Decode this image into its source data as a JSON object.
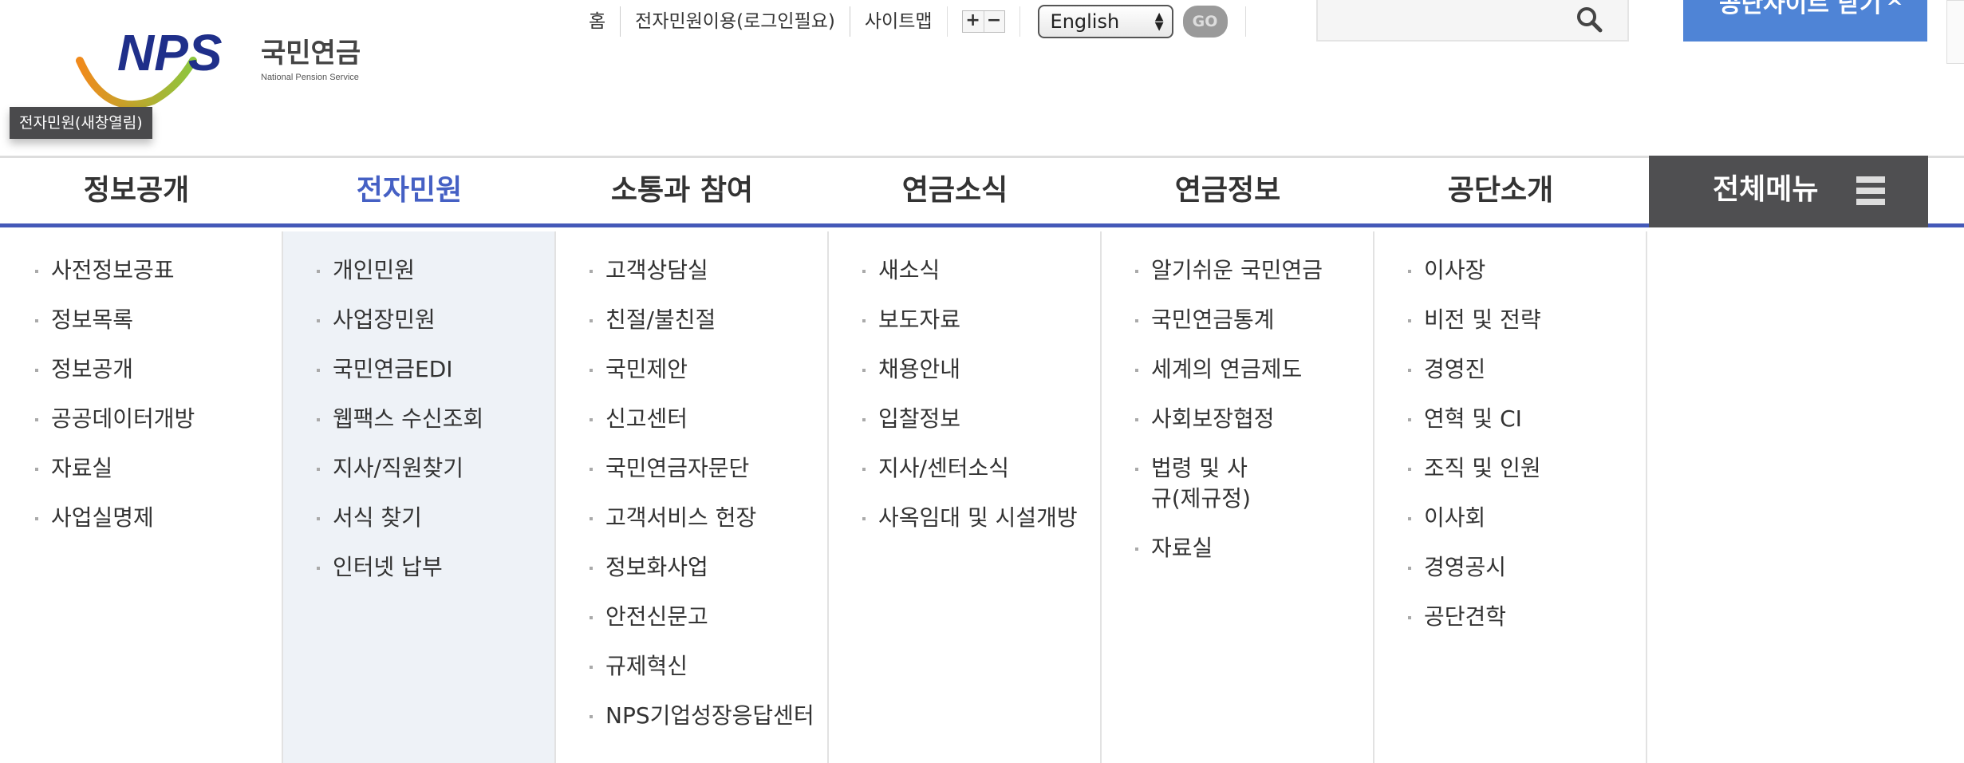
{
  "logo": {
    "text": "NPS",
    "korean": "국민연금",
    "english": "National Pension Service"
  },
  "tooltip": "전자민원(새창열림)",
  "top_links": [
    "홈",
    "전자민원이용(로그인필요)",
    "사이트맵"
  ],
  "zoom": {
    "plus": "+",
    "minus": "−"
  },
  "language": {
    "selected": "English",
    "go": "GO"
  },
  "search": {
    "placeholder": ""
  },
  "close_button": {
    "label": "공단사이트 닫기",
    "icon": "caret-up"
  },
  "nav": {
    "items": [
      "정보공개",
      "전자민원",
      "소통과 참여",
      "연금소식",
      "연금정보",
      "공단소개"
    ],
    "active": "전자민원",
    "all_menu": "전체메뉴"
  },
  "colors": {
    "accent": "#4560c4",
    "close_button": "#4f84d6",
    "all_menu_bg": "#4f4f51"
  },
  "submenu": [
    [
      "사전정보공표",
      "정보목록",
      "정보공개",
      "공공데이터개방",
      "자료실",
      "사업실명제"
    ],
    [
      "개인민원",
      "사업장민원",
      "국민연금EDI",
      "웹팩스 수신조회",
      "지사/직원찾기",
      "서식 찾기",
      "인터넷 납부"
    ],
    [
      "고객상담실",
      "친절/불친절",
      "국민제안",
      "신고센터",
      "국민연금자문단",
      "고객서비스 헌장",
      "정보화사업",
      "안전신문고",
      "규제혁신",
      "NPS기업성장응답센터"
    ],
    [
      "새소식",
      "보도자료",
      "채용안내",
      "입찰정보",
      "지사/센터소식",
      "사옥임대 및 시설개방"
    ],
    [
      "알기쉬운 국민연금",
      "국민연금통계",
      "세계의 연금제도",
      "사회보장협정",
      "법령 및 사규(제규정)",
      "자료실"
    ],
    [
      "이사장",
      "비전 및 전략",
      "경영진",
      "연혁 및 CI",
      "조직 및 인원",
      "이사회",
      "경영공시",
      "공단견학"
    ]
  ]
}
